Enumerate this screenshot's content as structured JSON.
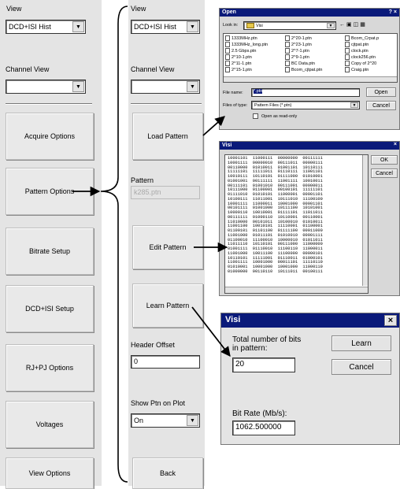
{
  "left_panel": {
    "view_label": "View",
    "view_value": "DCD+ISI Hist",
    "channel_view_label": "Channel View",
    "channel_view_value": "",
    "buttons": [
      "Acquire Options",
      "Pattern Options",
      "Bitrate Setup",
      "DCD+ISI Setup",
      "RJ+PJ Options",
      "Voltages",
      "View Options"
    ]
  },
  "mid_panel": {
    "view_label": "View",
    "view_value": "DCD+ISI Hist",
    "channel_view_label": "Channel View",
    "channel_view_value": "",
    "load_pattern": "Load Pattern",
    "pattern_label": "Pattern",
    "pattern_value": "k285.ptn",
    "edit_pattern": "Edit Pattern",
    "learn_pattern": "Learn Pattern",
    "header_offset_label": "Header Offset",
    "header_offset_value": "0",
    "show_ptn_label": "Show Ptn on Plot",
    "show_ptn_value": "On",
    "back": "Back"
  },
  "open_dialog": {
    "title": "Open",
    "title_controls": "? ×",
    "look_in_label": "Look in:",
    "look_in_value": "Visi",
    "files": [
      "1333MHz.ptn",
      "2^20-1.ptn",
      "Bcom_Crpat.p",
      "1333MHz_long.ptn",
      "2^23-1.ptn",
      "cjtpat.ptn",
      "2.5 Gbps.ptn",
      "2^7-1.ptn",
      "clock.ptn",
      "2^10-1.ptn",
      "2^9-1.ptn",
      "clock256.ptn",
      "2^11-1.ptn",
      "BC Data.ptn",
      "Copy of 2^20",
      "2^15-1.ptn",
      "Bcom_cjtpat.ptn",
      "Craig.ptn"
    ],
    "file_name_label": "File name:",
    "file_name_value": "*.ptn",
    "files_of_type_label": "Files of type:",
    "files_of_type_value": "Pattern Files (*.ptn)",
    "read_only_label": "Open as read-only",
    "open_button": "Open",
    "cancel_button": "Cancel"
  },
  "visi_editor": {
    "title": "Visi",
    "close": "×",
    "ok_button": "OK",
    "cancel_button": "Cancel",
    "rows": [
      "10001101  11000111  00000000  00111111",
      "10001111  00000010  00111011  00000111",
      "00110000  01010011  01001101  10110111",
      "11111101  11111011  01110111  11001101",
      "10010111  10110101  01111000  01010001",
      "01001001  00111111  11001111  10010011",
      "00111101  01001010  00111001  00000011",
      "10111000  01100001  00100101  11111101",
      "01111010  01010101  11000001  00001101",
      "10100111  11011001  10111010  11100100",
      "10001111  11000011  10001000  00001101",
      "00101111  01001000  10111100  10101001",
      "10000110  10010001  01111101  11011011",
      "00111111  01000110  10110001  00110001",
      "11010000  00101011  10100010  01010011",
      "11001100  10010101  11110001  01100001",
      "01100101  01101100  01111100  00011000",
      "11001000  01011101  01010010  00001111",
      "01100010  11100010  10000010  01011011",
      "11011110  10110101  00111000  11000000",
      "01001111  01110010  11100110  11000011",
      "11001000  10011100  11100000  00000101",
      "10110101  11111001  01110011  01000101",
      "11001111  10001000  00011101  11110110",
      "01010001  10001000  10001000  11000110",
      "01000000  00110110  10111011  00100111"
    ]
  },
  "learn_dialog": {
    "title": "Visi",
    "close": "×",
    "total_bits_label": "Total number of bits in pattern:",
    "total_bits_value": "20",
    "bit_rate_label": "Bit Rate (Mb/s):",
    "bit_rate_value": "1062.500000",
    "learn_button": "Learn",
    "cancel_button": "Cancel"
  }
}
